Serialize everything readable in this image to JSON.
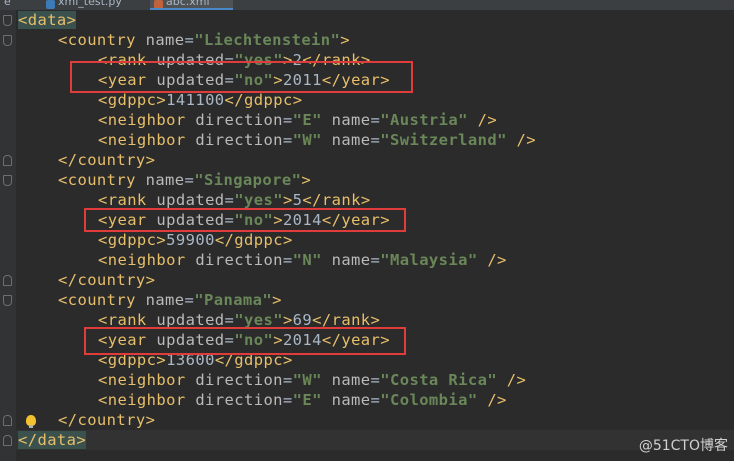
{
  "tabs": [
    {
      "label": "e",
      "active": false
    },
    {
      "label": "xml_test.py",
      "active": false,
      "icon": "python-file-icon"
    },
    {
      "label": "abc.xml",
      "active": true,
      "icon": "xml-file-icon"
    }
  ],
  "xml": {
    "root_open": "data",
    "root_close": "data",
    "countries": [
      {
        "name": "Liechtenstein",
        "rank": {
          "updated": "yes",
          "value": "2"
        },
        "year": {
          "updated": "no",
          "value": "2011"
        },
        "gdppc": "141100",
        "neighbors": [
          {
            "direction": "E",
            "name": "Austria"
          },
          {
            "direction": "W",
            "name": "Switzerland"
          }
        ]
      },
      {
        "name": "Singapore",
        "rank": {
          "updated": "yes",
          "value": "5"
        },
        "year": {
          "updated": "no",
          "value": "2014"
        },
        "gdppc": "59900",
        "neighbors": [
          {
            "direction": "N",
            "name": "Malaysia"
          }
        ]
      },
      {
        "name": "Panama",
        "rank": {
          "updated": "yes",
          "value": "69"
        },
        "year": {
          "updated": "no",
          "value": "2014"
        },
        "gdppc": "13600",
        "neighbors": [
          {
            "direction": "W",
            "name": "Costa Rica"
          },
          {
            "direction": "E",
            "name": "Colombia"
          }
        ]
      }
    ]
  },
  "highlight_color": "#e03c3c",
  "watermark": "@51CTO博客"
}
